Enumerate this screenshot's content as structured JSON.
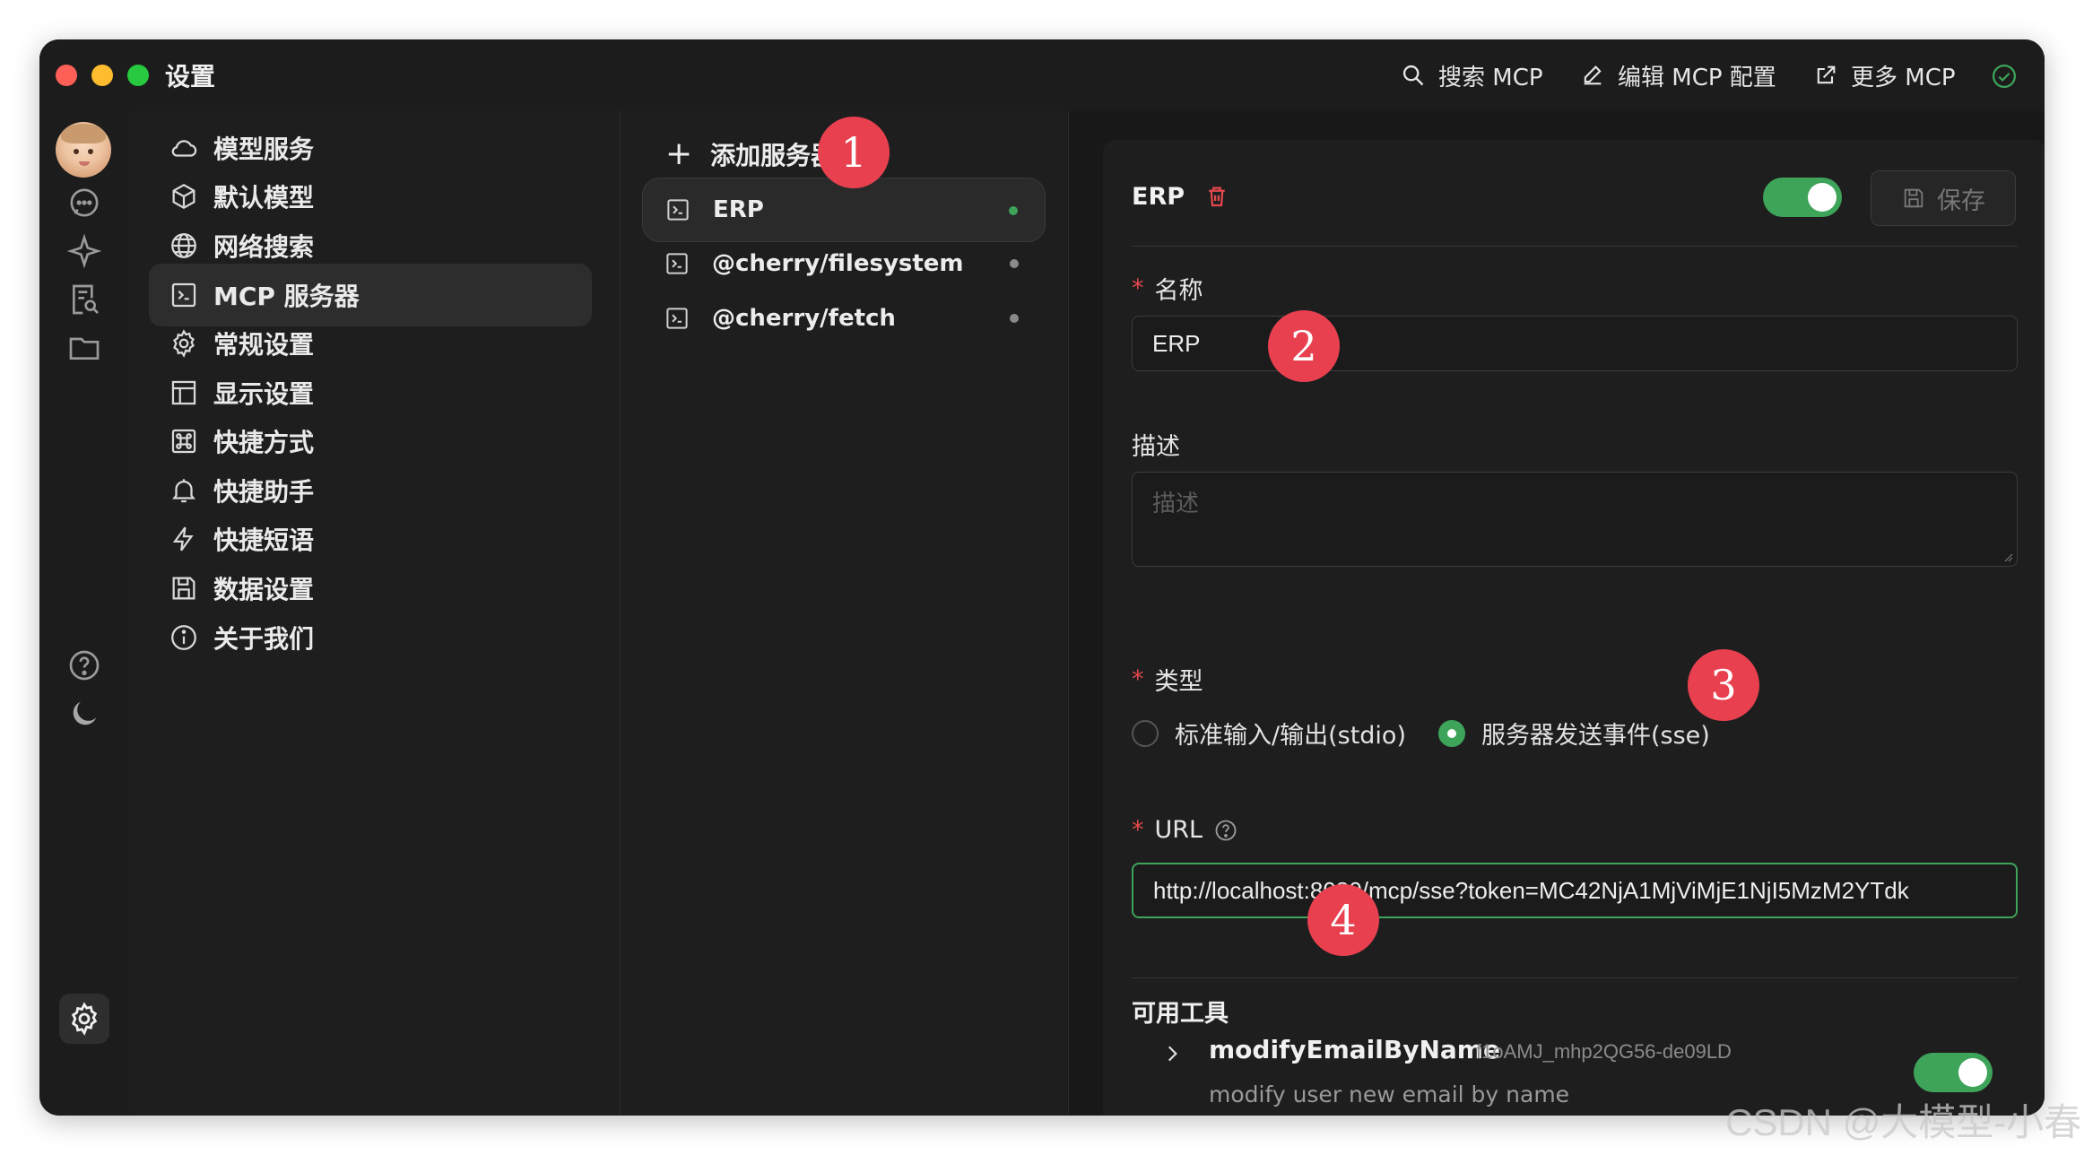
{
  "window": {
    "title": "设置",
    "actions": {
      "search": "搜索 MCP",
      "edit": "编辑 MCP 配置",
      "more": "更多 MCP"
    }
  },
  "rail": {
    "icons": [
      "avatar",
      "chat-icon",
      "sparkle-icon",
      "notes-search-icon",
      "folder-icon",
      "help-icon",
      "moon-icon",
      "gear-icon"
    ]
  },
  "nav": {
    "items": [
      {
        "label": "模型服务",
        "icon": "cloud-icon"
      },
      {
        "label": "默认模型",
        "icon": "cube-icon"
      },
      {
        "label": "网络搜索",
        "icon": "globe-icon"
      },
      {
        "label": "MCP 服务器",
        "icon": "terminal-icon",
        "active": true
      },
      {
        "label": "常规设置",
        "icon": "gear-icon"
      },
      {
        "label": "显示设置",
        "icon": "layout-icon"
      },
      {
        "label": "快捷方式",
        "icon": "command-icon"
      },
      {
        "label": "快捷助手",
        "icon": "bell-icon"
      },
      {
        "label": "快捷短语",
        "icon": "zap-icon"
      },
      {
        "label": "数据设置",
        "icon": "save-icon"
      },
      {
        "label": "关于我们",
        "icon": "info-icon"
      }
    ]
  },
  "servers": {
    "add_label": "添加服务器",
    "items": [
      {
        "name": "ERP",
        "active": true,
        "status_color": "#3ea45a"
      },
      {
        "name": "@cherry/filesystem",
        "active": false,
        "status_color": "#8a8a8a"
      },
      {
        "name": "@cherry/fetch",
        "active": false,
        "status_color": "#8a8a8a"
      }
    ]
  },
  "detail": {
    "title": "ERP",
    "enabled": true,
    "save_label": "保存",
    "name_label": "名称",
    "name_value": "ERP",
    "desc_label": "描述",
    "desc_placeholder": "描述",
    "type_label": "类型",
    "type_options": [
      "标准输入/输出(stdio)",
      "服务器发送事件(sse)"
    ],
    "type_selected": "服务器发送事件(sse)",
    "url_label": "URL",
    "url_value": "http://localhost:8080/mcp/sse?token=MC42NjA1MjViMjE1NjI5MzM2YTdk",
    "tools_label": "可用工具",
    "tools": [
      {
        "name": "modifyEmailByName",
        "id": "f1oAMJ_mhp2QG56-de09LD",
        "description": "modify user new email by name",
        "enabled": true
      }
    ]
  },
  "annotations": [
    "1",
    "2",
    "3",
    "4"
  ],
  "watermark": "CSDN @大模型-小春",
  "colors": {
    "accent_green": "#3ea45a",
    "badge_red": "#e8404f",
    "danger_red": "#e5484d"
  }
}
